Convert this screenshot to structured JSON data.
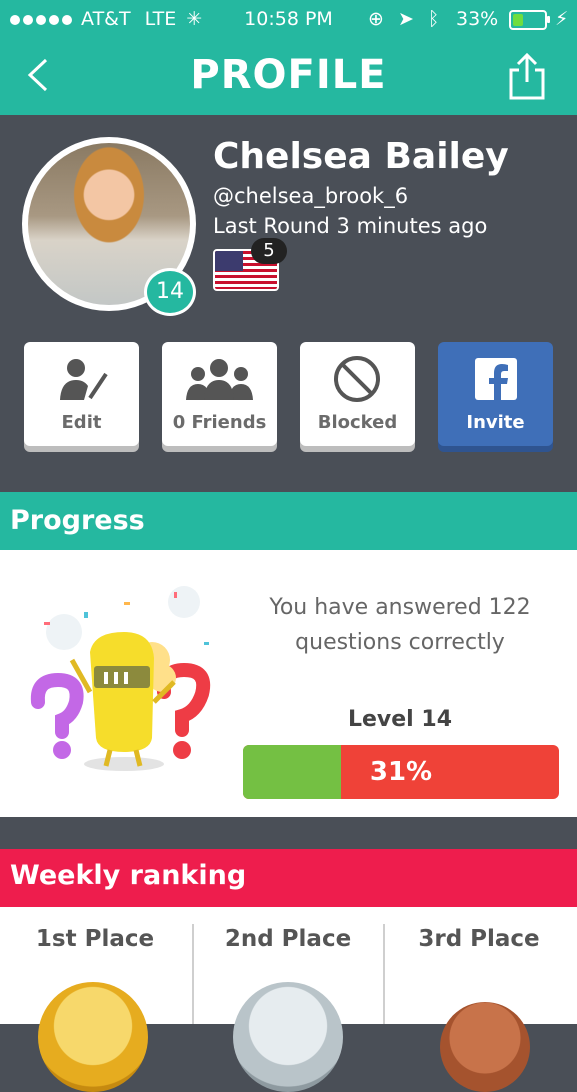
{
  "status_bar": {
    "carrier": "AT&T",
    "network": "LTE",
    "time": "10:58 PM",
    "battery_percent": "33%",
    "battery_level": 0.33
  },
  "header": {
    "title": "PROFILE",
    "back_icon": "chevron-left-icon",
    "share_icon": "share-icon"
  },
  "profile": {
    "name": "Chelsea Bailey",
    "handle": "@chelsea_brook_6",
    "last_round": "Last Round 3 minutes ago",
    "level": "14",
    "flag_count": "5",
    "actions": [
      {
        "label": "Edit",
        "icon": "edit-user-icon"
      },
      {
        "label": "0 Friends",
        "icon": "friends-icon"
      },
      {
        "label": "Blocked",
        "icon": "blocked-icon"
      },
      {
        "label": "Invite",
        "icon": "facebook-icon"
      }
    ]
  },
  "progress": {
    "title": "Progress",
    "answered_text": "You have answered 122 questions correctly",
    "level_label": "Level 14",
    "percent_text": "31%",
    "percent_value": 0.31
  },
  "weekly": {
    "title": "Weekly ranking",
    "places": [
      "1st Place",
      "2nd Place",
      "3rd Place"
    ]
  },
  "colors": {
    "teal": "#25b8a0",
    "dark": "#4a4f57",
    "facebook": "#3f6fb8",
    "red": "#ef4238",
    "green": "#74c043",
    "ranking": "#ee1d4d"
  }
}
